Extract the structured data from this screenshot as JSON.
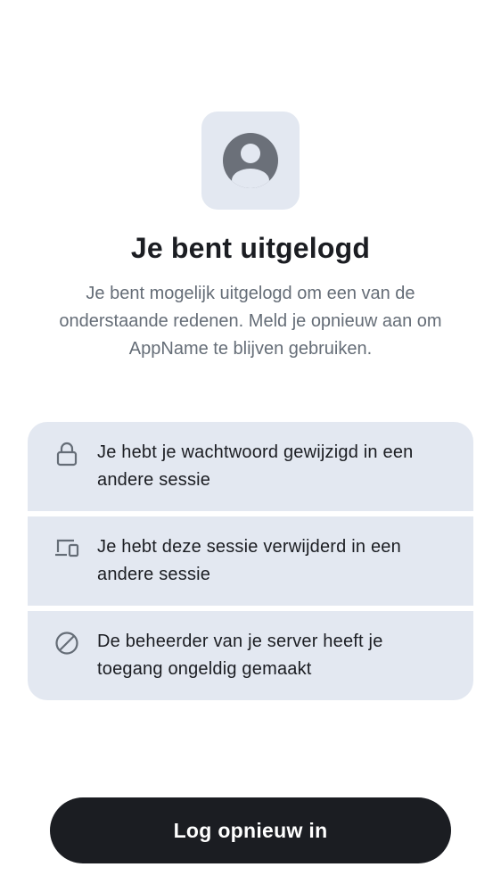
{
  "header": {
    "icon": "user-avatar-icon",
    "title": "Je bent uitgelogd",
    "subtitle": "Je bent mogelijk uitgelogd om een van de onderstaande redenen. Meld je opnieuw aan om AppName te blijven gebruiken."
  },
  "reasons": [
    {
      "icon": "lock-icon",
      "text": "Je hebt je wachtwoord gewijzigd in een andere sessie"
    },
    {
      "icon": "devices-icon",
      "text": "Je hebt deze sessie verwijderd in een andere sessie"
    },
    {
      "icon": "block-icon",
      "text": "De beheerder van je server heeft je toegang ongeldig gemaakt"
    }
  ],
  "actions": {
    "login_label": "Log opnieuw in"
  },
  "colors": {
    "tile_background": "#e3e8f1",
    "icon_color": "#656d77",
    "button_background": "#1b1d22",
    "button_text": "#ffffff"
  }
}
